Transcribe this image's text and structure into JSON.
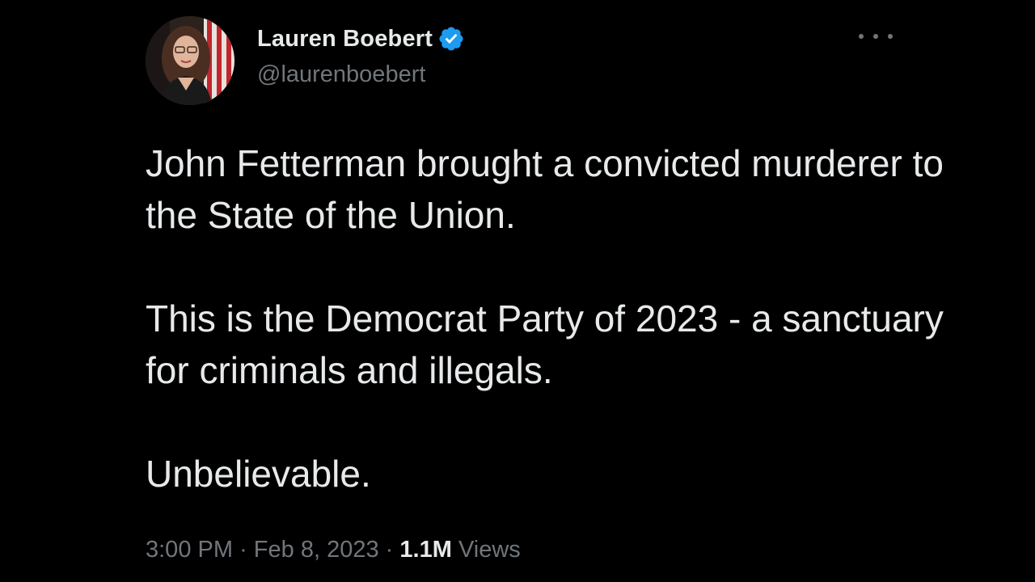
{
  "author": {
    "display_name": "Lauren Boebert",
    "handle": "@laurenboebert",
    "verified": true
  },
  "tweet": {
    "paragraph1": "John Fetterman brought a convicted murderer to the State of the Union.",
    "paragraph2": "This is the Democrat Party of 2023 - a sanctuary for criminals and illegals.",
    "paragraph3": "Unbelievable.",
    "time": "3:00 PM",
    "separator": "·",
    "date": "Feb 8, 2023",
    "views_count": "1.1M",
    "views_label": "Views"
  },
  "colors": {
    "background": "#000000",
    "text": "#e7e9ea",
    "secondary": "#71767b",
    "verified_blue": "#1d9bf0"
  },
  "icons": {
    "verified": "verified-badge-icon",
    "more": "more-options-icon"
  }
}
